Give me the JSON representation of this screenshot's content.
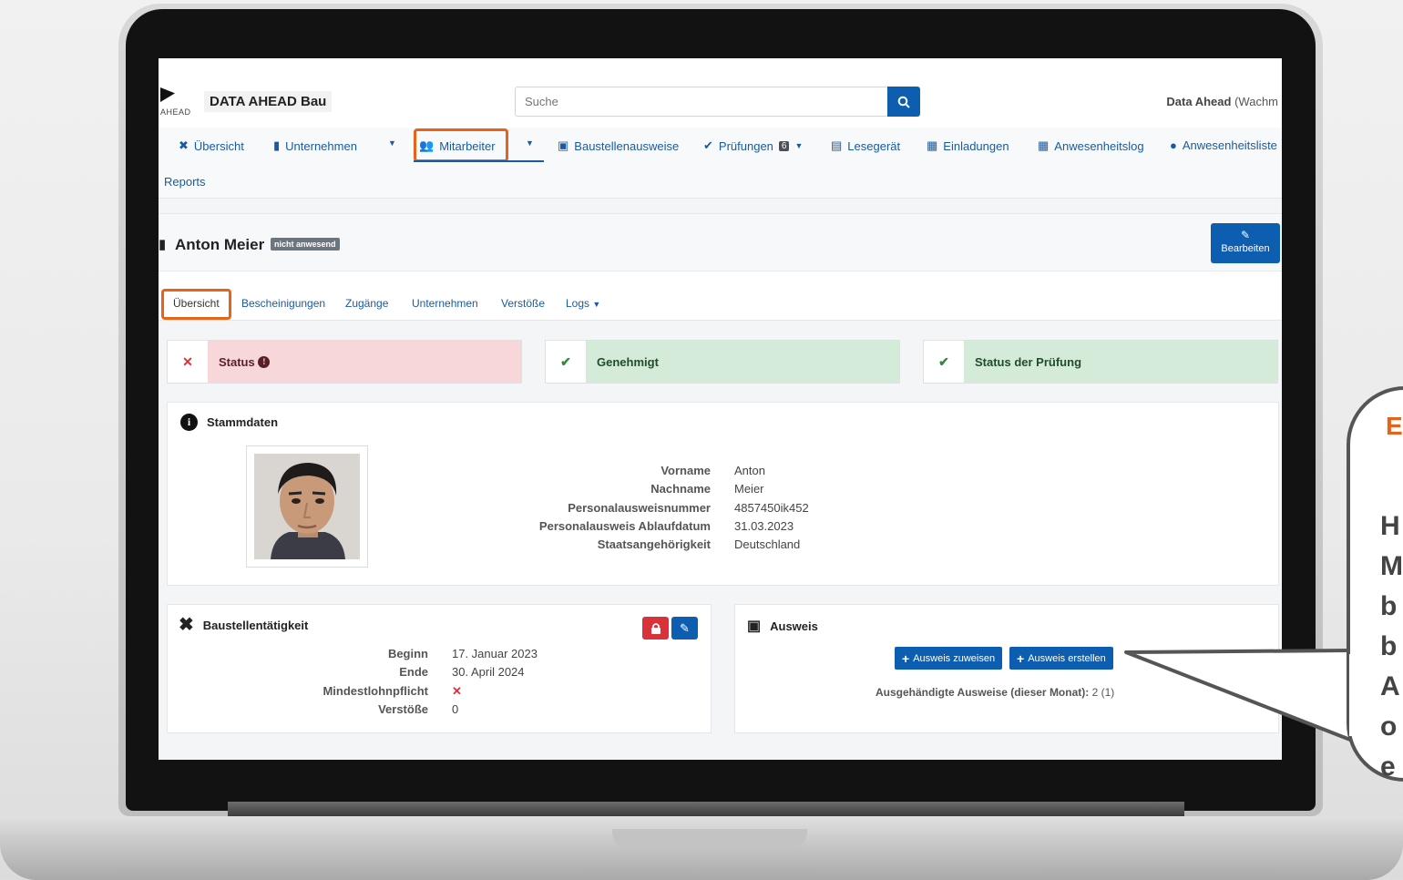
{
  "app": {
    "logo_text": "AHEAD",
    "company": "DATA AHEAD Bau",
    "search_placeholder": "Suche",
    "user_name": "Data Ahead",
    "user_role": "(Wachm"
  },
  "nav": {
    "items": [
      {
        "label": "Übersicht",
        "icon": "tools-icon"
      },
      {
        "label": "Unternehmen",
        "icon": "building-icon"
      },
      {
        "label": "Mitarbeiter",
        "icon": "users-icon"
      },
      {
        "label": "Baustellenausweise",
        "icon": "id-badge-icon"
      },
      {
        "label": "Prüfungen",
        "icon": "check-icon",
        "badge": "6"
      },
      {
        "label": "Lesegerät",
        "icon": "card-reader-icon"
      },
      {
        "label": "Einladungen",
        "icon": "invite-icon"
      },
      {
        "label": "Anwesenheitslog",
        "icon": "calendar-icon"
      },
      {
        "label": "Anwesenheitsliste",
        "icon": "clock-icon"
      }
    ],
    "reports": "Reports"
  },
  "person": {
    "name": "Anton Meier",
    "status_badge": "nicht anwesend",
    "edit_label": "Bearbeiten"
  },
  "tabs": [
    "Übersicht",
    "Bescheinigungen",
    "Zugänge",
    "Unternehmen",
    "Verstöße",
    "Logs"
  ],
  "status_cards": [
    {
      "label": "Status",
      "state": "error"
    },
    {
      "label": "Genehmigt",
      "state": "ok"
    },
    {
      "label": "Status der Prüfung",
      "state": "ok"
    }
  ],
  "stammdaten": {
    "title": "Stammdaten",
    "fields": [
      {
        "key": "Vorname",
        "value": "Anton"
      },
      {
        "key": "Nachname",
        "value": "Meier"
      },
      {
        "key": "Personalausweisnummer",
        "value": "4857450ik452"
      },
      {
        "key": "Personalausweis Ablaufdatum",
        "value": "31.03.2023"
      },
      {
        "key": "Staatsangehörigkeit",
        "value": "Deutschland"
      }
    ]
  },
  "baustelle": {
    "title": "Baustellentätigkeit",
    "fields": [
      {
        "key": "Beginn",
        "value": "17. Januar 2023"
      },
      {
        "key": "Ende",
        "value": "30. April 2024"
      },
      {
        "key": "Mindestlohnpflicht",
        "value": "✕"
      },
      {
        "key": "Verstöße",
        "value": "0"
      }
    ]
  },
  "ausweis": {
    "title": "Ausweis",
    "assign_label": "Ausweis zuweisen",
    "create_label": "Ausweis erstellen",
    "issued_label": "Ausgehändigte Ausweise (dieser Monat):",
    "issued_value": "2 (1)"
  },
  "callout": {
    "title": "E",
    "lines": [
      "H",
      "M",
      "b",
      "b",
      "A",
      "o",
      "e"
    ]
  },
  "colors": {
    "primary": "#0d5eb1",
    "highlight": "#e8621a",
    "danger": "#d9323a",
    "success": "#2f8a3f"
  }
}
